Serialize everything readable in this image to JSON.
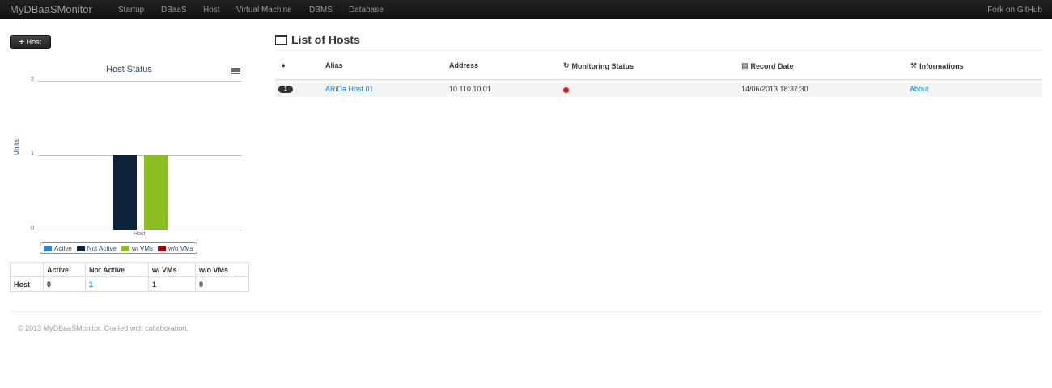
{
  "nav": {
    "brand": "MyDBaaSMonitor",
    "items": [
      "Startup",
      "DBaaS",
      "Host",
      "Virtual Machine",
      "DBMS",
      "Database"
    ],
    "fork": "Fork on GitHub"
  },
  "sidebar": {
    "add_button": "Host"
  },
  "chart_data": {
    "type": "bar",
    "title": "Host Status",
    "ylabel": "Units",
    "categories": [
      "Host"
    ],
    "ylim": [
      0,
      2
    ],
    "yticks": [
      "0",
      "1",
      "2"
    ],
    "series": [
      {
        "name": "Active",
        "values": [
          0
        ],
        "color": "#2f7ed8"
      },
      {
        "name": "Not Active",
        "values": [
          1
        ],
        "color": "#0d233a"
      },
      {
        "name": "w/ VMs",
        "values": [
          1
        ],
        "color": "#8bbc21"
      },
      {
        "name": "w/o VMs",
        "values": [
          0
        ],
        "color": "#910000"
      }
    ],
    "legend": "bottom",
    "grid": true
  },
  "summary": {
    "headers": [
      "Active",
      "Not Active",
      "w/ VMs",
      "w/o VMs"
    ],
    "row_label": "Host",
    "values": [
      "0",
      "1",
      "1",
      "0"
    ]
  },
  "main": {
    "title": "List of Hosts",
    "columns": {
      "alias": "Alias",
      "address": "Address",
      "monitoring": "Monitoring Status",
      "record_date": "Record Date",
      "info": "Informations"
    },
    "rows": [
      {
        "index": "1",
        "alias": "ARiDa Host 01",
        "address": "10.110.10.01",
        "status_color": "#c82829",
        "record_date": "14/06/2013 18:37:30",
        "info": "About"
      }
    ]
  },
  "footer": "© 2013 MyDBaaSMonitor. Crafted with collaboration."
}
